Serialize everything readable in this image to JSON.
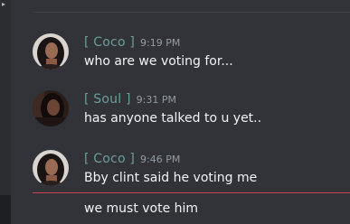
{
  "messages": [
    {
      "username": "[ Coco ]",
      "timestamp": "9:19 PM",
      "lines": [
        "who are we voting for..."
      ]
    },
    {
      "username": "[ Soul ]",
      "timestamp": "9:31 PM",
      "lines": [
        "has anyone talked to u yet.."
      ]
    },
    {
      "username": "[ Coco ]",
      "timestamp": "9:46 PM",
      "lines": [
        "Bby clint said he voting me",
        "we must vote him"
      ]
    }
  ],
  "colors": {
    "background": "#313338",
    "username": "#6b9e9c",
    "timestamp": "#949ba4",
    "text": "#f2f3f5",
    "new_messages_divider": "#c9474c"
  },
  "icons": {
    "collapse_arrow": "chevron-right-icon"
  }
}
